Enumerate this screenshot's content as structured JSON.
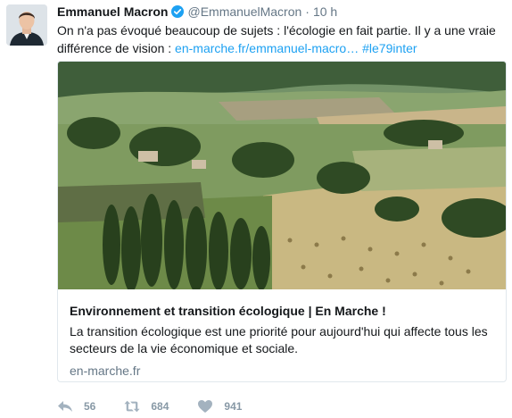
{
  "author": {
    "name": "Emmanuel Macron",
    "handle": "@EmmanuelMacron",
    "time": "10 h"
  },
  "tweet": {
    "text": "On n'a pas évoqué beaucoup de sujets : l'écologie en fait partie. Il y a une vraie différence de vision : ",
    "link": "en-marche.fr/emmanuel-macro…",
    "hashtag": "#le79inter"
  },
  "card": {
    "title": "Environnement et transition écologique | En Marche !",
    "description": "La transition écologique est une priorité pour aujourd'hui qui affecte tous les secteurs de la vie économique et sociale.",
    "domain": "en-marche.fr"
  },
  "actions": {
    "replies": "56",
    "retweets": "684",
    "likes": "941"
  },
  "colors": {
    "link": "#1da1f2",
    "muted": "#657786",
    "verified": "#1da1f2"
  },
  "icons": [
    "verified-badge-icon",
    "reply-icon",
    "retweet-icon",
    "like-icon"
  ]
}
